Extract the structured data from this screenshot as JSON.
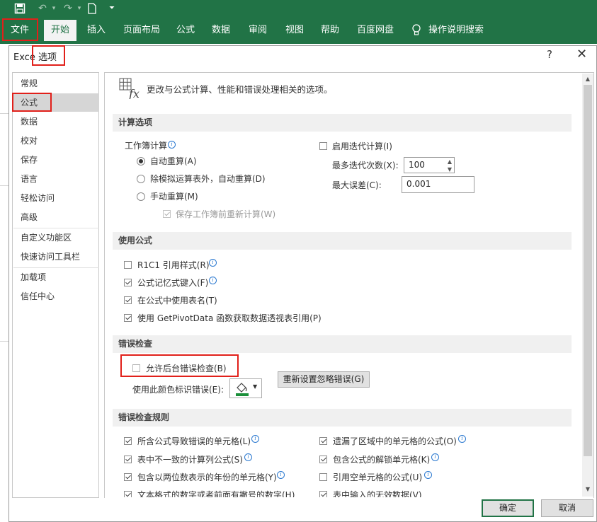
{
  "ribbon": {
    "tabs": [
      "文件",
      "开始",
      "插入",
      "页面布局",
      "公式",
      "数据",
      "审阅",
      "视图",
      "帮助",
      "百度网盘"
    ],
    "tell_me": "操作说明搜索"
  },
  "dialog": {
    "title_prefix": "Exce",
    "title": "选项",
    "help": "?",
    "close": "✕",
    "nav": [
      "常规",
      "公式",
      "数据",
      "校对",
      "保存",
      "语言",
      "轻松访问",
      "高级",
      "自定义功能区",
      "快速访问工具栏",
      "加载项",
      "信任中心"
    ],
    "header_text": "更改与公式计算、性能和错误处理相关的选项。",
    "ok": "确定",
    "cancel": "取消"
  },
  "calc": {
    "section": "计算选项",
    "workbook_calc": "工作簿计算",
    "auto": "自动重算(A)",
    "auto_except": "除模拟运算表外，自动重算(D)",
    "manual": "手动重算(M)",
    "recalc_save": "保存工作簿前重新计算(W)",
    "iterative": "启用迭代计算(I)",
    "max_iter_label": "最多迭代次数(X):",
    "max_iter": "100",
    "max_change_label": "最大误差(C):",
    "max_change": "0.001"
  },
  "formulas": {
    "section": "使用公式",
    "r1c1": "R1C1 引用样式(R)",
    "autocomplete": "公式记忆式键入(F)",
    "table_names": "在公式中使用表名(T)",
    "pivot": "使用 GetPivotData 函数获取数据透视表引用(P)"
  },
  "errcheck": {
    "section": "错误检查",
    "background": "允许后台错误检查(B)",
    "color_label": "使用此颜色标识错误(E):",
    "reset": "重新设置忽略错误(G)"
  },
  "rules": {
    "section": "错误检查规则",
    "items": [
      "所含公式导致错误的单元格(L)",
      "表中不一致的计算列公式(S)",
      "包含以两位数表示的年份的单元格(Y)",
      "文本格式的数字或者前面有撇号的数字(H)",
      "遗漏了区域中的单元格的公式(O)",
      "包含公式的解锁单元格(K)",
      "引用空单元格的公式(U)",
      "表中输入的无效数据(V)"
    ]
  },
  "colors": {
    "ribbon": "#217346",
    "highlight": "#e1201a",
    "ok_border": "#217346"
  }
}
